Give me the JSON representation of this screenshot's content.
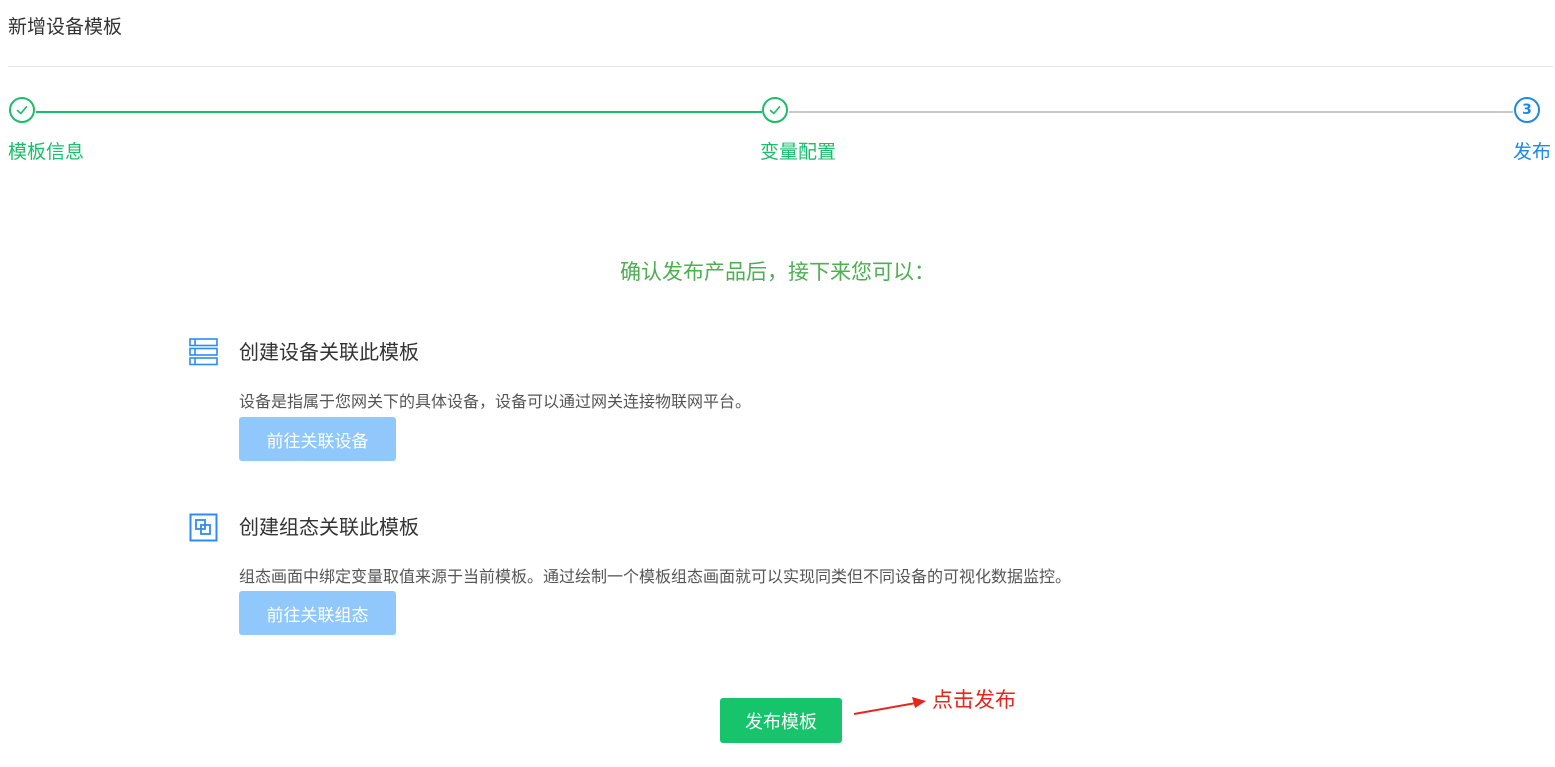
{
  "page": {
    "title": "新增设备模板"
  },
  "steps": [
    {
      "label": "模板信息",
      "state": "done"
    },
    {
      "label": "变量配置",
      "state": "done"
    },
    {
      "label": "发布",
      "number": "3",
      "state": "active"
    }
  ],
  "content": {
    "headline": "确认发布产品后，接下来您可以：",
    "sections": [
      {
        "icon": "list-icon",
        "title": "创建设备关联此模板",
        "description": "设备是指属于您网关下的具体设备，设备可以通过网关连接物联网平台。",
        "button_label": "前往关联设备"
      },
      {
        "icon": "layers-icon",
        "title": "创建组态关联此模板",
        "description": "组态画面中绑定变量取值来源于当前模板。通过绘制一个模板组态画面就可以实现同类但不同设备的可视化数据监控。",
        "button_label": "前往关联组态"
      }
    ],
    "publish_button_label": "发布模板"
  },
  "annotation": {
    "text": "点击发布",
    "color": "#e8251b"
  },
  "colors": {
    "success": "#19be6b",
    "active": "#1e88e5",
    "pending_line": "#c8c9cc",
    "disabled_button": "#90c8fb",
    "publish_button": "#17c46b"
  }
}
